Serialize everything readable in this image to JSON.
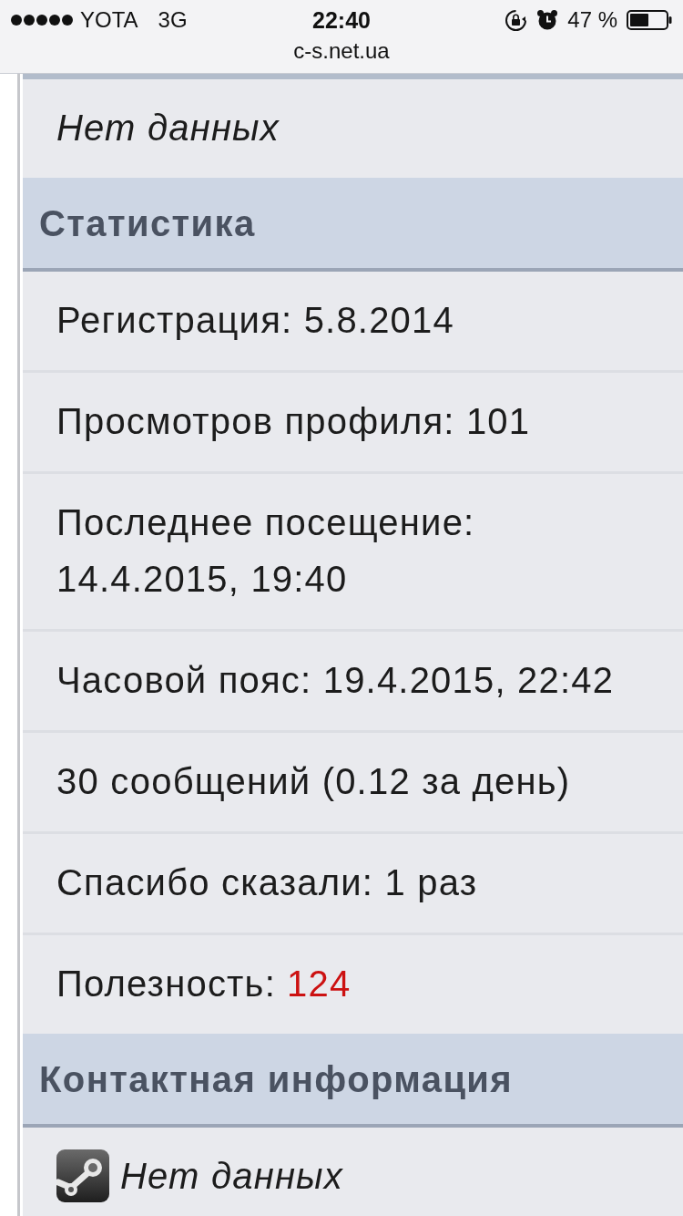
{
  "status_bar": {
    "carrier": "YOTA",
    "network": "3G",
    "time": "22:40",
    "battery": "47 %"
  },
  "address_bar": {
    "url": "c-s.net.ua"
  },
  "sections": [
    {
      "rows": [
        {
          "kind": "empty",
          "text": "Нет данных"
        }
      ]
    },
    {
      "title": "Статистика",
      "rows": [
        {
          "kind": "text",
          "text": "Регистрация: 5.8.2014"
        },
        {
          "kind": "text",
          "text": "Просмотров профиля: 101"
        },
        {
          "kind": "text",
          "text": "Последнее посещение: 14.4.2015, 19:40"
        },
        {
          "kind": "text",
          "text": "Часовой пояс: 19.4.2015, 22:42"
        },
        {
          "kind": "text",
          "text": "30 сообщений (0.12 за день)"
        },
        {
          "kind": "text",
          "text": "Спасибо сказали: 1 раз"
        },
        {
          "kind": "reputation",
          "label": "Полезность:",
          "value": "124"
        }
      ]
    },
    {
      "title": "Контактная информация",
      "rows": [
        {
          "kind": "contact",
          "text": "Нет данных"
        }
      ]
    }
  ]
}
